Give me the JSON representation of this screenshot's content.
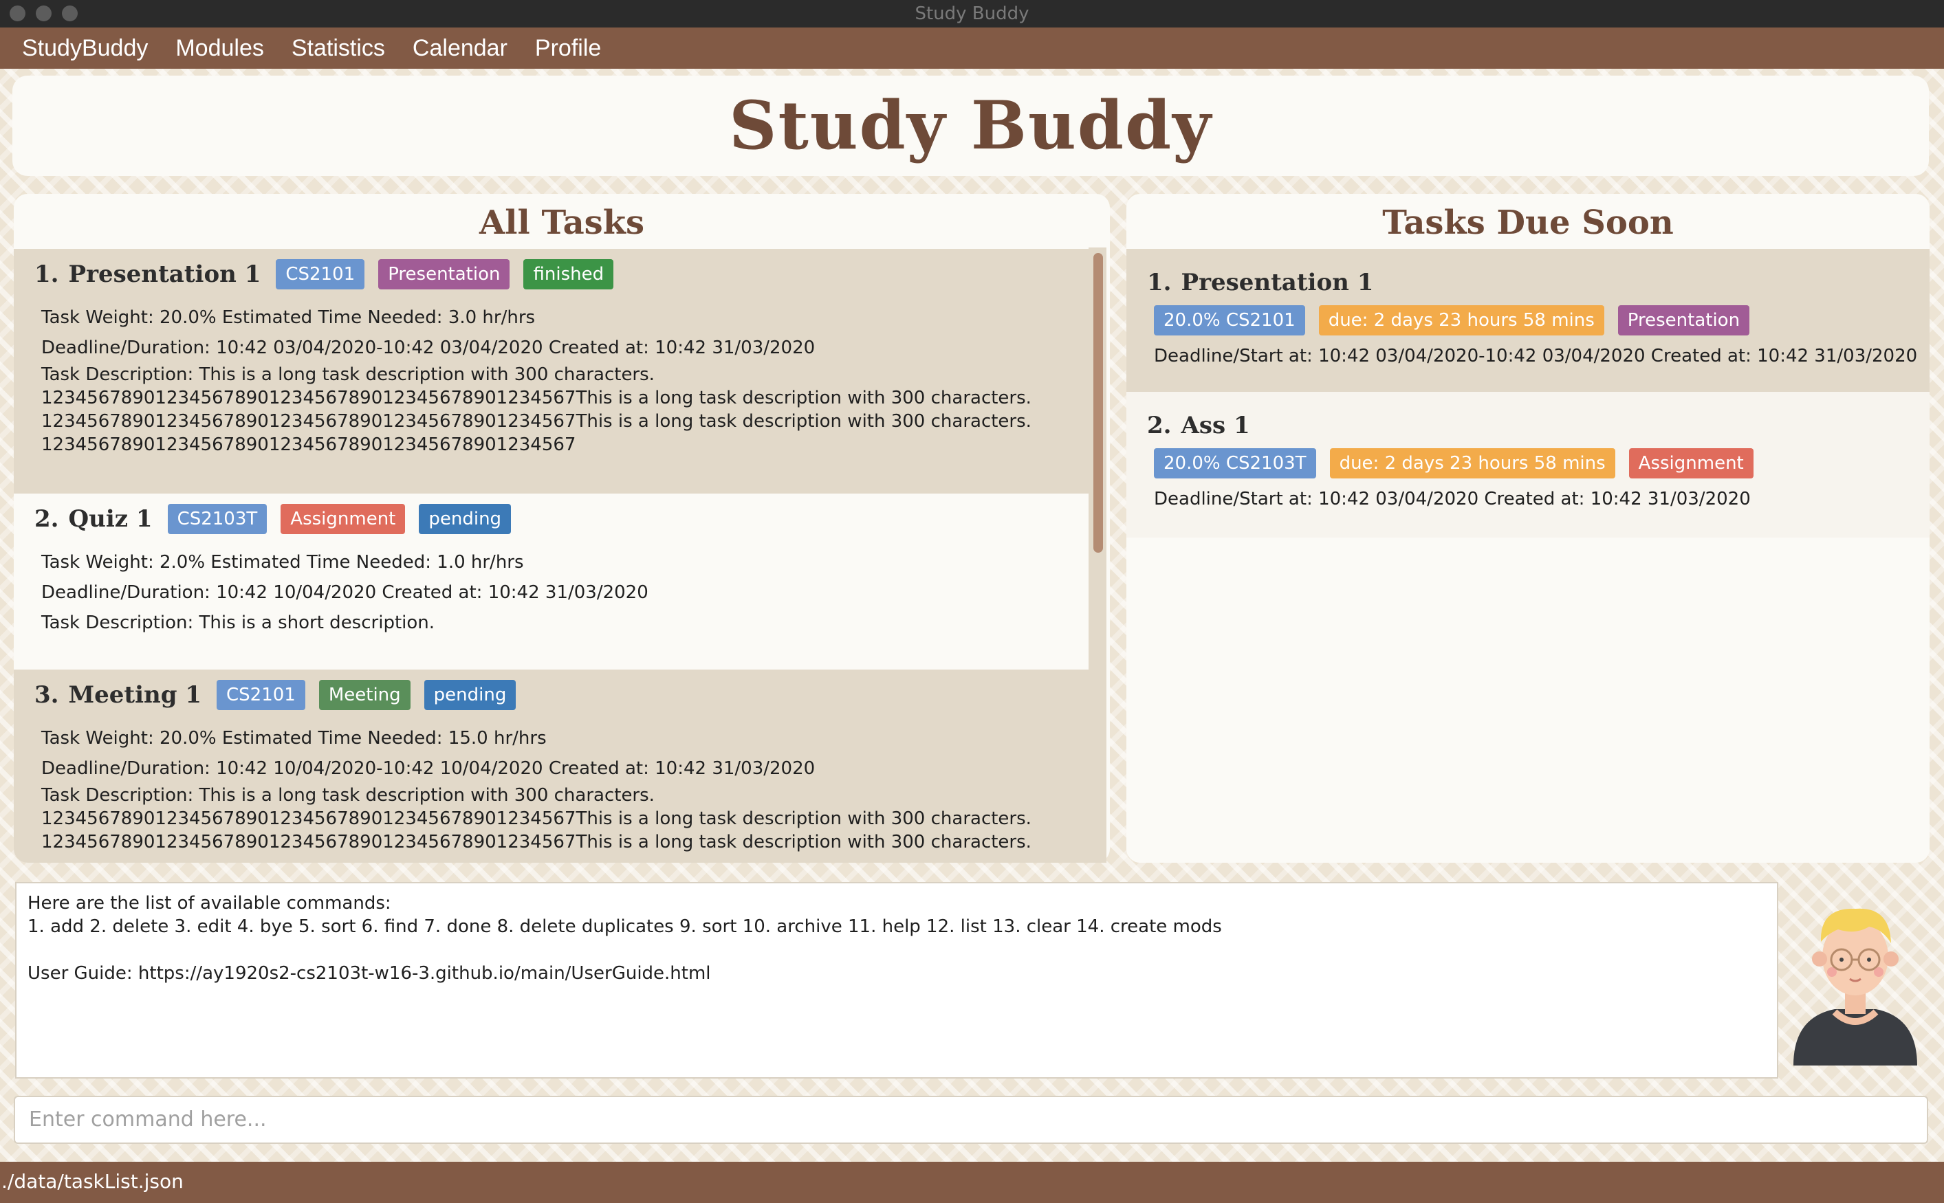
{
  "window": {
    "title": "Study Buddy"
  },
  "menu": {
    "items": [
      "StudyBuddy",
      "Modules",
      "Statistics",
      "Calendar",
      "Profile"
    ]
  },
  "banner": {
    "title": "Study Buddy"
  },
  "all_tasks": {
    "header": "All Tasks",
    "tasks": [
      {
        "index": "1.",
        "title": "Presentation 1",
        "tags": [
          "CS2101",
          "Presentation",
          "finished"
        ],
        "line1": "Task Weight: 20.0%   Estimated Time Needed: 3.0 hr/hrs",
        "line2": "Deadline/Duration: 10:42 03/04/2020-10:42 03/04/2020   Created at: 10:42 31/03/2020",
        "desc": [
          "Task Description: This is a long task description with 300 characters.",
          "12345678901234567890123456789012345678901234567This is a long task description with 300 characters.",
          "12345678901234567890123456789012345678901234567This is a long task description with 300 characters.",
          "12345678901234567890123456789012345678901234567"
        ]
      },
      {
        "index": "2.",
        "title": "Quiz 1",
        "tags": [
          "CS2103T",
          "Assignment",
          "pending"
        ],
        "line1": "Task Weight: 2.0%   Estimated Time Needed: 1.0 hr/hrs",
        "line2": "Deadline/Duration: 10:42 10/04/2020   Created at: 10:42 31/03/2020",
        "desc": [
          "Task Description: This is a short description."
        ]
      },
      {
        "index": "3.",
        "title": "Meeting 1",
        "tags": [
          "CS2101",
          "Meeting",
          "pending"
        ],
        "line1": "Task Weight: 20.0%   Estimated Time Needed: 15.0 hr/hrs",
        "line2": "Deadline/Duration: 10:42 10/04/2020-10:42 10/04/2020   Created at: 10:42 31/03/2020",
        "desc": [
          "Task Description: This is a long task description with 300 characters.",
          "12345678901234567890123456789012345678901234567This is a long task description with 300 characters.",
          "12345678901234567890123456789012345678901234567This is a long task description with 300 characters."
        ]
      }
    ]
  },
  "due_soon": {
    "header": "Tasks Due Soon",
    "tasks": [
      {
        "index": "1.",
        "title": "Presentation 1",
        "tags": [
          "20.0% CS2101",
          "due: 2 days 23 hours 58 mins",
          "Presentation"
        ],
        "line": "Deadline/Start at: 10:42 03/04/2020-10:42 03/04/2020   Created at: 10:42 31/03/2020"
      },
      {
        "index": "2.",
        "title": "Ass 1",
        "tags": [
          "20.0% CS2103T",
          "due: 2 days 23 hours 58 mins",
          "Assignment"
        ],
        "line": "Deadline/Start at: 10:42 03/04/2020   Created at: 10:42 31/03/2020"
      }
    ]
  },
  "result": {
    "lines": [
      "Here are the list of available commands:",
      "1. add  2. delete  3. edit  4. bye  5. sort  6. find  7. done  8. delete duplicates  9. sort  10. archive  11. help  12. list  13. clear 14. create mods",
      "",
      "User Guide: https://ay1920s2-cs2103t-w16-3.github.io/main/UserGuide.html"
    ]
  },
  "command": {
    "placeholder": "Enter command here..."
  },
  "status": {
    "path": "./data/taskList.json"
  },
  "colors": {
    "brown": "#825a45",
    "title_brown": "#6e4a38",
    "card_shaded": "#e2d9c9",
    "tag_blue": "#6a95cf",
    "tag_purple": "#a15c96",
    "tag_green": "#3c9446",
    "tag_red": "#e06c5c",
    "tag_orange": "#f3ab4a",
    "tag_status_blue": "#3c7ab7"
  },
  "icons": {
    "avatar": "avatar-icon",
    "window_controls": [
      "close-icon",
      "minimize-icon",
      "zoom-icon"
    ]
  }
}
